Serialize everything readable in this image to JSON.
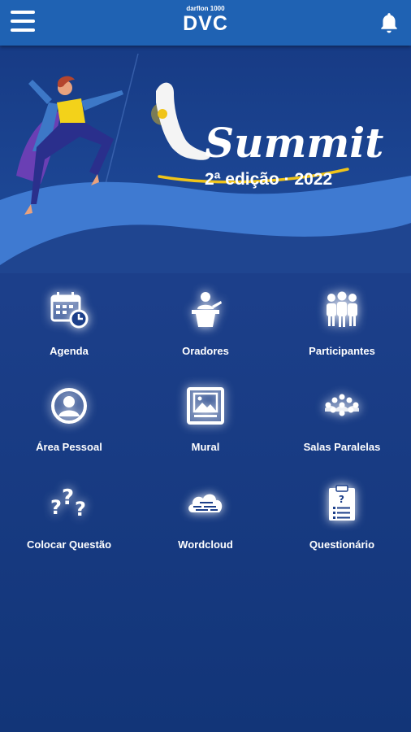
{
  "header": {
    "logo_small": "darflon 1000",
    "logo_main": "DVC"
  },
  "banner": {
    "title": "Summit",
    "edition": "2ª edição · 2022"
  },
  "menu": [
    {
      "label": "Agenda",
      "icon": "calendar-clock-icon"
    },
    {
      "label": "Oradores",
      "icon": "speaker-podium-icon"
    },
    {
      "label": "Participantes",
      "icon": "people-group-icon"
    },
    {
      "label": "Área Pessoal",
      "icon": "user-profile-icon"
    },
    {
      "label": "Mural",
      "icon": "picture-frame-icon"
    },
    {
      "label": "Salas Paralelas",
      "icon": "rooms-network-icon"
    },
    {
      "label": "Colocar Questão",
      "icon": "question-marks-icon"
    },
    {
      "label": "Wordcloud",
      "icon": "word-cloud-icon"
    },
    {
      "label": "Questionário",
      "icon": "clipboard-question-icon"
    }
  ],
  "colors": {
    "header": "#1f62b3",
    "background": "#1c3f8a",
    "wave_light": "#3f7ad1",
    "accent_yellow": "#f0c419"
  }
}
